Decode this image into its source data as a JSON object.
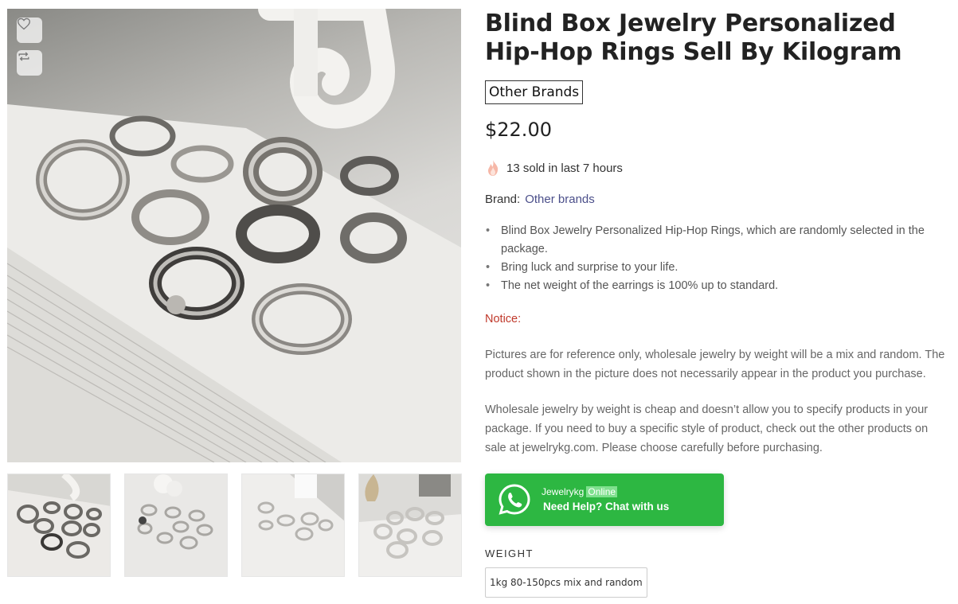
{
  "product": {
    "title": "Blind Box Jewelry Personalized Hip-Hop Rings Sell By Kilogram",
    "brand_badge": "Other Brands",
    "price": "$22.00",
    "sold_text": "13 sold in last 7 hours",
    "brand_label": "Brand:",
    "brand_value": "Other brands"
  },
  "gallery": {
    "main_image_alt": "Assorted silver hip-hop rings on white book pages",
    "thumbnails": [
      "thumb-1",
      "thumb-2",
      "thumb-3",
      "thumb-4"
    ],
    "selected_index": 0
  },
  "description": {
    "bullets": [
      "Blind Box Jewelry Personalized Hip-Hop Rings, which are randomly selected in the package.",
      "Bring luck and surprise to your life.",
      "The net weight of the earrings is 100% up to standard."
    ],
    "notice_label": "Notice:",
    "paragraphs": [
      "Pictures are for reference only, wholesale jewelry by weight will be a mix and random. The product shown in the picture does not necessarily appear in the product you purchase.",
      "Wholesale jewelry by weight is cheap and doesn’t allow you to specify products in your package. If you need to buy a specific style of product, check out the other products on sale at jewelrykg.com. Please choose carefully before purchasing."
    ]
  },
  "whatsapp": {
    "name": "Jewelrykg",
    "status": "Online",
    "help_text": "Need Help? Chat with us",
    "color": "#2db742"
  },
  "weight": {
    "label": "WEIGHT",
    "options": [
      "1kg 80-150pcs mix and random"
    ]
  },
  "colors": {
    "notice": "#c0392b",
    "brand_link": "#4b4f8a"
  }
}
